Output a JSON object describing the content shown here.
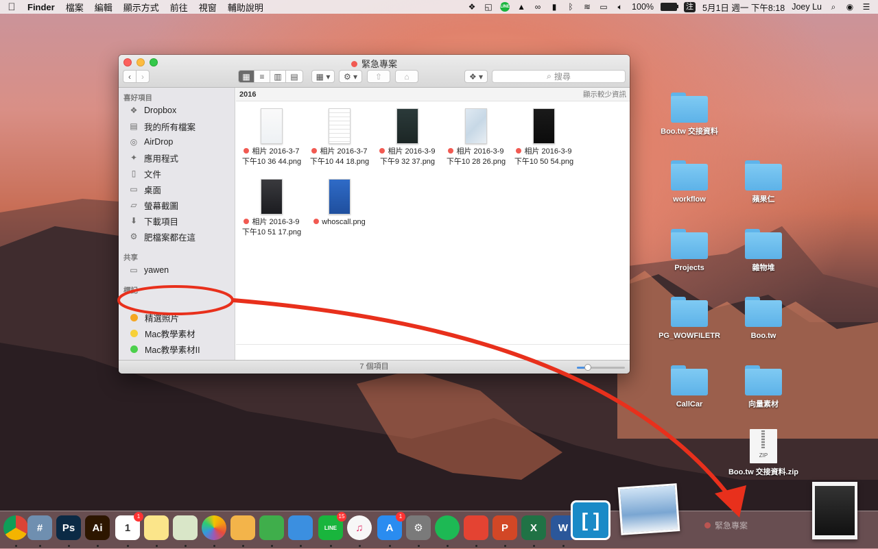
{
  "menubar": {
    "app_name": "Finder",
    "menus": [
      "檔案",
      "編輯",
      "顯示方式",
      "前往",
      "視窗",
      "輔助說明"
    ],
    "line_label": "LINE",
    "battery": "100%",
    "battery_level": 1.0,
    "input_method": "注",
    "datetime": "5月1日 週一 下午8:18",
    "user": "Joey Lu"
  },
  "finder": {
    "title": "緊急專案",
    "search_placeholder": "搜尋",
    "sidebar": {
      "favorites_header": "喜好項目",
      "favorites": [
        {
          "label": "Dropbox",
          "icon": "dropbox-icon"
        },
        {
          "label": "我的所有檔案",
          "icon": "all-files-icon"
        },
        {
          "label": "AirDrop",
          "icon": "airdrop-icon"
        },
        {
          "label": "應用程式",
          "icon": "applications-icon"
        },
        {
          "label": "文件",
          "icon": "documents-icon"
        },
        {
          "label": "桌面",
          "icon": "desktop-icon"
        },
        {
          "label": "螢幕截圖",
          "icon": "folder-icon"
        },
        {
          "label": "下載項目",
          "icon": "downloads-icon"
        },
        {
          "label": "肥檔案都在這",
          "icon": "gear-folder-icon"
        }
      ],
      "shared_header": "共享",
      "shared": [
        {
          "label": "yawen",
          "icon": "computer-icon"
        }
      ],
      "tags_header": "標記",
      "tags": [
        {
          "label": "精選照片",
          "color": "#f5a623"
        },
        {
          "label": "Mac教學素材",
          "color": "#f7d038"
        },
        {
          "label": "Mac教學素材II",
          "color": "#4cd04c"
        }
      ]
    },
    "group_title": "2016",
    "show_less": "顯示較少資訊",
    "files": [
      {
        "line1": "相片 2016-3-7",
        "line2": "下午10 36 44.png",
        "thumb": "light"
      },
      {
        "line1": "相片 2016-3-7",
        "line2": "下午10 44 18.png",
        "thumb": "light"
      },
      {
        "line1": "相片 2016-3-9",
        "line2": "下午9 32 37.png",
        "thumb": "dark"
      },
      {
        "line1": "相片 2016-3-9",
        "line2": "下午10 28 26.png",
        "thumb": "map"
      },
      {
        "line1": "相片 2016-3-9",
        "line2": "下午10 50 54.png",
        "thumb": "black"
      },
      {
        "line1": "相片 2016-3-9",
        "line2": "下午10 51 17.png",
        "thumb": "dark"
      },
      {
        "line1": "whoscall.png",
        "line2": "",
        "thumb": "blue"
      }
    ],
    "status": "7 個項目",
    "icon_size_level": 0.18
  },
  "desktop": {
    "items": [
      {
        "label": "Boo.tw 交接資料",
        "type": "folder"
      },
      {
        "label": "workflow",
        "type": "folder"
      },
      {
        "label": "蘋果仁",
        "type": "folder"
      },
      {
        "label": "Projects",
        "type": "folder"
      },
      {
        "label": "雜物堆",
        "type": "folder"
      },
      {
        "label": "PG_WOWFILETR",
        "type": "folder"
      },
      {
        "label": "Boo.tw",
        "type": "folder"
      },
      {
        "label": "CallCar",
        "type": "folder"
      },
      {
        "label": "向量素材",
        "type": "folder"
      },
      {
        "label": "Boo.tw 交接資料.zip",
        "type": "zip",
        "badge": "ZIP"
      }
    ]
  },
  "dock": {
    "apps": [
      {
        "name": "chrome-icon",
        "label": "",
        "color": "#e8e8e8"
      },
      {
        "name": "xcode-simulator-icon",
        "label": "#",
        "color": "#6f8fb0"
      },
      {
        "name": "photoshop-icon",
        "label": "Ps",
        "color": "#0b2a45"
      },
      {
        "name": "illustrator-icon",
        "label": "Ai",
        "color": "#2d1600"
      },
      {
        "name": "calendar-icon",
        "label": "1",
        "color": "#ffffff",
        "badge": "1",
        "sublabel": "5月"
      },
      {
        "name": "notes-icon",
        "label": "",
        "color": "#fbe58a"
      },
      {
        "name": "preview-icon",
        "label": "",
        "color": "#d9e6c8"
      },
      {
        "name": "photos-icon",
        "label": "",
        "color": "#ffffff"
      },
      {
        "name": "pages-icon",
        "label": "",
        "color": "#f3b44a"
      },
      {
        "name": "numbers-icon",
        "label": "",
        "color": "#3fae4b"
      },
      {
        "name": "keynote-icon",
        "label": "",
        "color": "#3b8fe0"
      },
      {
        "name": "line-icon",
        "label": "LINE",
        "color": "#19b53d",
        "badge": "15"
      },
      {
        "name": "itunes-icon",
        "label": "♫",
        "color": "#f7f7f7"
      },
      {
        "name": "app-store-icon",
        "label": "A",
        "color": "#2a8cf0",
        "badge": "1"
      },
      {
        "name": "system-preferences-icon",
        "label": "⚙",
        "color": "#7a7a7a"
      },
      {
        "name": "spotify-icon",
        "label": "",
        "color": "#1db954"
      },
      {
        "name": "todoist-icon",
        "label": "",
        "color": "#e44332"
      },
      {
        "name": "powerpoint-icon",
        "label": "P",
        "color": "#d24726"
      },
      {
        "name": "excel-icon",
        "label": "X",
        "color": "#207245"
      },
      {
        "name": "word-icon",
        "label": "W",
        "color": "#2b579a"
      },
      {
        "name": "brackets-icon",
        "label": "",
        "color": "#1a8ac7"
      },
      {
        "name": "preview-photos-icon",
        "label": "",
        "color": "#a8c8e8"
      }
    ],
    "drop_label": "緊急專案"
  }
}
